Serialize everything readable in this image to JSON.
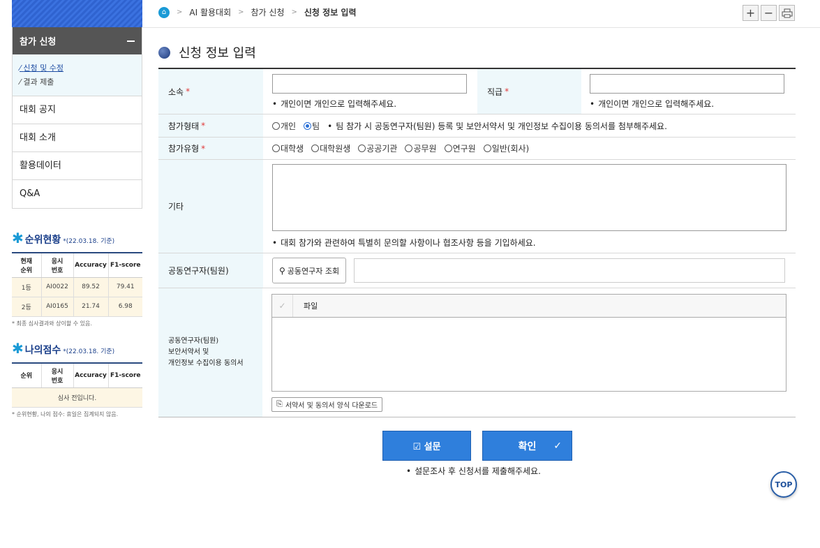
{
  "breadcrumb": {
    "items": [
      "AI 활용대회",
      "참가 신청"
    ],
    "current": "신청 정보 입력"
  },
  "toolbar": {
    "zoom_in": "+",
    "zoom_out": "−"
  },
  "sidebar": {
    "section_title": "참가 신청",
    "sub_items": [
      "신청 및 수정",
      "결과 제출"
    ],
    "items": [
      "대회 공지",
      "대회 소개",
      "활용데이터",
      "Q&A"
    ]
  },
  "ranking": {
    "title": "순위현황",
    "date": "*(22.03.18. 기준)",
    "headers": [
      "현재\n순위",
      "응시\n번호",
      "Accuracy",
      "F1-score"
    ],
    "rows": [
      [
        "1등",
        "AI0022",
        "89.52",
        "79.41"
      ],
      [
        "2등",
        "AI0165",
        "21.74",
        "6.98"
      ]
    ],
    "note": "* 최종 심사결과와 상이할 수 있음."
  },
  "my_score": {
    "title": "나의점수",
    "date": "*(22.03.18. 기준)",
    "headers": [
      "순위",
      "응시\n번호",
      "Accuracy",
      "F1-score"
    ],
    "empty": "심사 전입니다.",
    "note": "* 순위현황, 나의 점수: 휴일은 집계되지 않음."
  },
  "page": {
    "title": "신청 정보 입력"
  },
  "form": {
    "affiliation_label": "소속",
    "affiliation_hint": "개인이면 개인으로 입력해주세요.",
    "position_label": "직급",
    "position_hint": "개인이면 개인으로 입력해주세요.",
    "type_label": "참가형태",
    "type_options": [
      "개인",
      "팀"
    ],
    "type_selected": "팀",
    "type_hint": "팀 참가 시 공동연구자(팀원) 등록 및 보안서약서 및 개인정보 수집이용 동의서를 첨부해주세요.",
    "category_label": "참가유형",
    "category_options": [
      "대학생",
      "대학원생",
      "공공기관",
      "공무원",
      "연구원",
      "일반(회사)"
    ],
    "etc_label": "기타",
    "etc_hint": "대회 참가와 관련하여 특별히 문의할 사항이나 협조사항 등을 기입하세요.",
    "coresearcher_label": "공동연구자(팀원)",
    "coresearcher_search": "공동연구자 조회",
    "consent_label": "공동연구자(팀원)\n보안서약서 및\n개인정보 수집이용 동의서",
    "file_header": "파일",
    "download_label": "서약서 및 동의서 양식 다운로드"
  },
  "actions": {
    "survey_label": "☑ 설문",
    "confirm_label": "확인",
    "hint": "설문조사 후 신청서를 제출해주세요."
  },
  "top_button": "TOP"
}
